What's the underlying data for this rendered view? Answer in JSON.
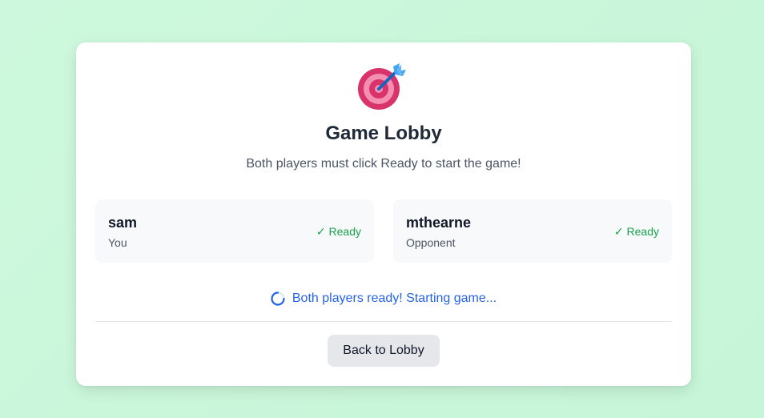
{
  "lobby": {
    "icon": "dart-target-icon",
    "title": "Game Lobby",
    "subtitle": "Both players must click Ready to start the game!"
  },
  "players": [
    {
      "name": "sam",
      "role": "You",
      "status": "✓ Ready"
    },
    {
      "name": "mthearne",
      "role": "Opponent",
      "status": "✓ Ready"
    }
  ],
  "status_message": "Both players ready! Starting game...",
  "actions": {
    "back_label": "Back to Lobby"
  },
  "colors": {
    "background": "#cdf8dd",
    "ready": "#16a34a",
    "status": "#2563eb",
    "button": "#e5e7eb"
  }
}
